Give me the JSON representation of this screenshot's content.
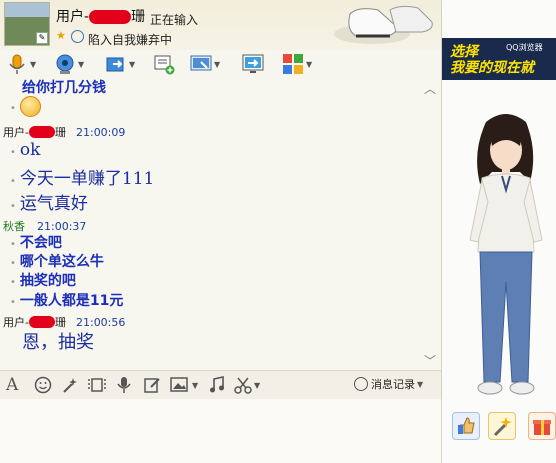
{
  "header": {
    "contact_name": "用户-",
    "contact_name_suffix": "珊",
    "typing_status": "正在输入",
    "signature": "陷入自我嫌弃中"
  },
  "toolbar": {
    "icons": [
      "microphone-icon",
      "video-camera-icon",
      "send-file-icon",
      "add-note-icon",
      "remote-desktop-icon",
      "screen-share-icon",
      "apps-icon"
    ]
  },
  "messages": {
    "partial_top": "给你打几分钱",
    "m1": {
      "sender_prefix": "用户-",
      "sender_suffix": "珊",
      "time": "21:00:09",
      "lines": [
        "ok",
        "今天一单赚了111",
        "运气真好"
      ]
    },
    "m2": {
      "sender": "秋香",
      "time": "21:00:37",
      "lines": [
        "不会吧",
        "哪个单这么牛",
        "抽奖的吧",
        "一般人都是11元"
      ]
    },
    "m3": {
      "sender_prefix": "用户-",
      "sender_suffix": "珊",
      "time": "21:00:56",
      "lines": [
        "恩，抽奖"
      ]
    }
  },
  "input_toolbar": {
    "icons": [
      "font-icon",
      "emoji-icon",
      "magic-icon",
      "screenshot-icon",
      "voice-icon",
      "edit-icon",
      "image-icon",
      "music-icon",
      "scissors-icon"
    ],
    "history_label": "消息记录"
  },
  "right_panel": {
    "banner_line1": "选择",
    "banner_line2": "我要的现在就",
    "banner_brand": "QQ浏览器"
  },
  "colors": {
    "message_blue": "#1b2e9e",
    "redaction_red": "#e2001b",
    "green_sender": "#227a22"
  }
}
